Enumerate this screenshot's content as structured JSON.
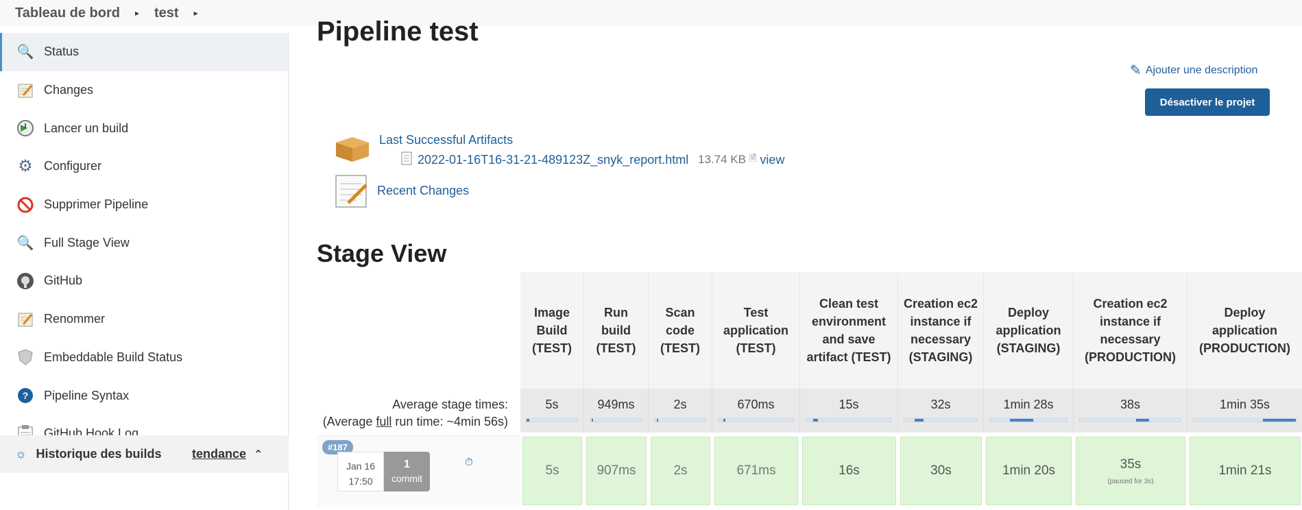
{
  "breadcrumb": {
    "root": "Tableau de bord",
    "job": "test"
  },
  "sidebar": {
    "items": [
      {
        "label": "Status",
        "icon": "magnifier-icon"
      },
      {
        "label": "Changes",
        "icon": "notepad-icon"
      },
      {
        "label": "Lancer un build",
        "icon": "clock-play-icon"
      },
      {
        "label": "Configurer",
        "icon": "gear-icon"
      },
      {
        "label": "Supprimer Pipeline",
        "icon": "no-entry-icon"
      },
      {
        "label": "Full Stage View",
        "icon": "magnifier-icon"
      },
      {
        "label": "GitHub",
        "icon": "github-icon"
      },
      {
        "label": "Renommer",
        "icon": "notepad-icon"
      },
      {
        "label": "Embeddable Build Status",
        "icon": "shield-icon"
      },
      {
        "label": "Pipeline Syntax",
        "icon": "help-icon"
      },
      {
        "label": "GitHub Hook Log",
        "icon": "clipboard-icon"
      }
    ],
    "history": {
      "label": "Historique des builds",
      "trend": "tendance"
    }
  },
  "main": {
    "title": "Pipeline test",
    "add_description": "Ajouter une description",
    "disable_button": "Désactiver le projet",
    "artifacts_label": "Last Successful Artifacts",
    "artifact_file": "2022-01-16T16-31-21-489123Z_snyk_report.html",
    "artifact_size": "13.74 KB",
    "artifact_view": "view",
    "recent_changes": "Recent Changes",
    "stage_view_title": "Stage View"
  },
  "stage_view": {
    "avg_label_line1": "Average stage times:",
    "avg_label_line2_pre": "(Average ",
    "avg_label_line2_u": "full",
    "avg_label_line2_post": " run time: ~4min 56s)",
    "stages": [
      {
        "name": "Image Build (TEST)",
        "avg": "5s",
        "run": "5s",
        "bar_fraction": 0.05
      },
      {
        "name": "Run build (TEST)",
        "avg": "949ms",
        "run": "907ms",
        "bar_fraction": 0.02
      },
      {
        "name": "Scan code (TEST)",
        "avg": "2s",
        "run": "2s",
        "bar_fraction": 0.02
      },
      {
        "name": "Test application (TEST)",
        "avg": "670ms",
        "run": "671ms",
        "bar_fraction": 0.02
      },
      {
        "name": "Clean test environment and save artifact (TEST)",
        "avg": "15s",
        "run": "16s",
        "bar_fraction": 0.06
      },
      {
        "name": "Creation ec2 instance if necessary (STAGING)",
        "avg": "32s",
        "run": "30s",
        "bar_fraction": 0.12
      },
      {
        "name": "Deploy application (STAGING)",
        "avg": "1min 28s",
        "run": "1min 20s",
        "bar_fraction": 0.3
      },
      {
        "name": "Creation ec2 instance if necessary (PRODUCTION)",
        "avg": "38s",
        "run": "35s",
        "run_note": "(paused for 3s)",
        "bar_fraction": 0.13
      },
      {
        "name": "Deploy application (PRODUCTION)",
        "avg": "1min 35s",
        "run": "1min 21s",
        "bar_fraction": 0.32
      }
    ],
    "build": {
      "number": "#187",
      "date": "Jan 16",
      "time": "17:50",
      "commit_count": "1",
      "commit_label": "commit"
    }
  }
}
